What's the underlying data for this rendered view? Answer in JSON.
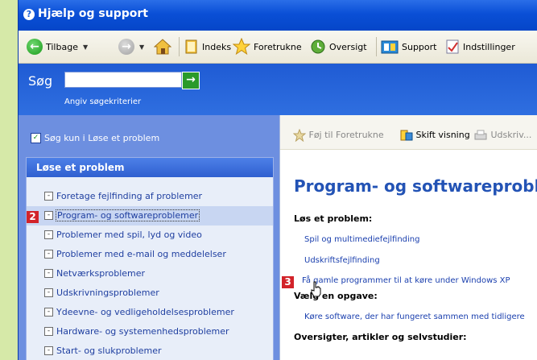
{
  "window": {
    "title": "Hjælp og support"
  },
  "toolbar": {
    "back_label": "Tilbage",
    "index_label": "Indeks",
    "favorites_label": "Foretrukne",
    "history_label": "Oversigt",
    "support_label": "Support",
    "options_label": "Indstillinger"
  },
  "search": {
    "label": "Søg",
    "hint": "Angiv søgekriterier",
    "value": ""
  },
  "filter": {
    "label": "Søg kun i Løse et problem",
    "checked": true
  },
  "panel": {
    "title": "Løse et problem",
    "items": [
      {
        "label": "Foretage fejlfinding af problemer"
      },
      {
        "label": "Program- og softwareproblemer"
      },
      {
        "label": "Problemer med spil, lyd og video"
      },
      {
        "label": "Problemer med e-mail og meddelelser"
      },
      {
        "label": "Netværksproblemer"
      },
      {
        "label": "Udskrivningsproblemer"
      },
      {
        "label": "Ydeevne- og vedligeholdelsesproblemer"
      },
      {
        "label": "Hardware- og systemenhedsproblemer"
      },
      {
        "label": "Start- og slukproblemer"
      }
    ]
  },
  "content_toolbar": {
    "add_favorite": "Føj til Foretrukne",
    "change_view": "Skift visning",
    "print": "Udskriv..."
  },
  "content": {
    "heading": "Program- og softwareproble",
    "section1": "Løs et problem:",
    "links1": [
      "Spil og multimediefejlfinding",
      "Udskriftsfejlfinding",
      "Få gamle programmer til at køre under Windows XP"
    ],
    "section2": "Vælg en opgave:",
    "links2": [
      "Køre software, der har fungeret sammen med tidligere"
    ],
    "section3": "Oversigter, artikler og selvstudier:"
  },
  "badges": {
    "b2": "2",
    "b3": "3"
  },
  "colors": {
    "title_blue": "#0a4fd6",
    "left_pane": "#6d8fe0",
    "badge_red": "#d2232a",
    "heading_blue": "#2353b5"
  }
}
